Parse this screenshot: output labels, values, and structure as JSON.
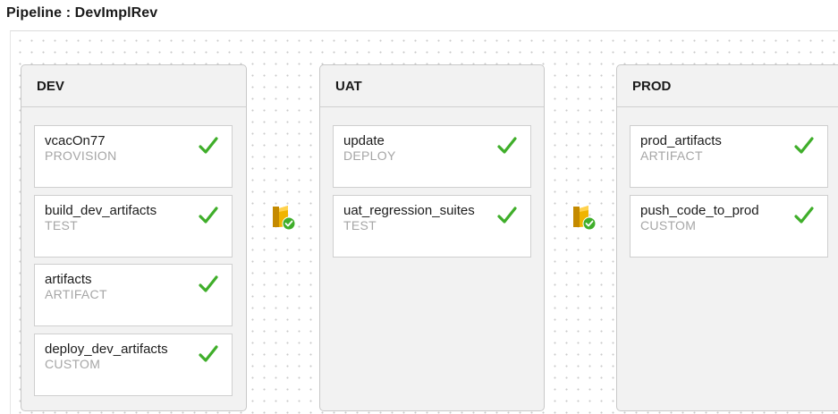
{
  "pipeline": {
    "title": "Pipeline : DevImplRev"
  },
  "colors": {
    "success": "#3fae2a",
    "gate_yellow": "#f0b400",
    "stage_bg": "#f2f2f2"
  },
  "icons": {
    "task_status": "check-icon",
    "gate": "gate-approved-icon"
  },
  "stages": [
    {
      "name": "DEV",
      "tasks": [
        {
          "name": "vcacOn77",
          "type": "PROVISION",
          "status": "success"
        },
        {
          "name": "build_dev_artifacts",
          "type": "TEST",
          "status": "success"
        },
        {
          "name": "artifacts",
          "type": "ARTIFACT",
          "status": "success"
        },
        {
          "name": "deploy_dev_artifacts",
          "type": "CUSTOM",
          "status": "success"
        }
      ]
    },
    {
      "name": "UAT",
      "tasks": [
        {
          "name": "update",
          "type": "DEPLOY",
          "status": "success"
        },
        {
          "name": "uat_regression_suites",
          "type": "TEST",
          "status": "success"
        }
      ]
    },
    {
      "name": "PROD",
      "tasks": [
        {
          "name": "prod_artifacts",
          "type": "ARTIFACT",
          "status": "success"
        },
        {
          "name": "push_code_to_prod",
          "type": "CUSTOM",
          "status": "success"
        }
      ]
    }
  ]
}
